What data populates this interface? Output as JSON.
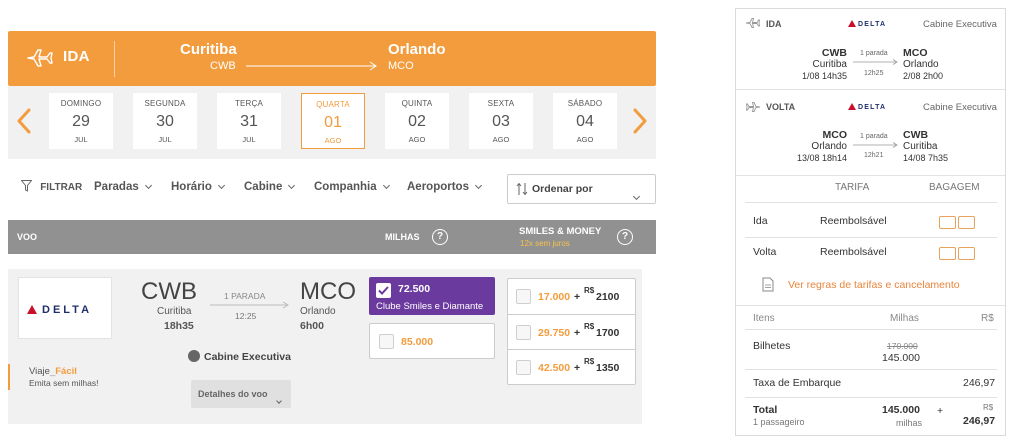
{
  "header": {
    "direction": "IDA",
    "origin_city": "Curitiba",
    "origin_code": "CWB",
    "dest_city": "Orlando",
    "dest_code": "MCO"
  },
  "dates": [
    {
      "dow": "DOMINGO",
      "day": "29",
      "month": "JUL"
    },
    {
      "dow": "SEGUNDA",
      "day": "30",
      "month": "JUL"
    },
    {
      "dow": "TERÇA",
      "day": "31",
      "month": "JUL"
    },
    {
      "dow": "QUARTA",
      "day": "01",
      "month": "AGO",
      "selected": true
    },
    {
      "dow": "QUINTA",
      "day": "02",
      "month": "AGO"
    },
    {
      "dow": "SEXTA",
      "day": "03",
      "month": "AGO"
    },
    {
      "dow": "SÁBADO",
      "day": "04",
      "month": "AGO"
    }
  ],
  "filters": {
    "filtrar": "FILTRAR",
    "paradas": "Paradas",
    "horario": "Horário",
    "cabine": "Cabine",
    "companhia": "Companhia",
    "aeroportos": "Aeroportos",
    "sort": "Ordenar por"
  },
  "table_header": {
    "voo": "VOO",
    "milhas": "MILHAS",
    "smiles_money": "SMILES & MONEY",
    "juros": "12x sem juros",
    "help": "?"
  },
  "flight": {
    "airline": "DELTA",
    "origin_code": "CWB",
    "origin_city": "Curitiba",
    "origin_time": "18h35",
    "stops": "1 PARADA",
    "duration": "12:25",
    "dest_code": "MCO",
    "dest_city": "Orlando",
    "dest_time": "6h00",
    "cabin": "Cabine Executiva",
    "promo_a": "Viaje",
    "promo_b": "Fácil",
    "promo_sub": "Emita sem milhas!",
    "details": "Detalhes do voo",
    "miles_selected_value": "72.500",
    "miles_selected_label": "Clube Smiles e Diamante",
    "miles_option": "85.000",
    "money_options": [
      {
        "miles": "17.000",
        "plus": "+",
        "currency": "R$",
        "price": "2100"
      },
      {
        "miles": "29.750",
        "plus": "+",
        "currency": "R$",
        "price": "1700"
      },
      {
        "miles": "42.500",
        "plus": "+",
        "currency": "R$",
        "price": "1350"
      }
    ]
  },
  "summary": {
    "outbound": {
      "label": "IDA",
      "airline": "DELTA",
      "cabin": "Cabine Executiva",
      "from_code": "CWB",
      "from_city": "Curitiba",
      "from_time": "1/08 14h35",
      "stops": "1 parada",
      "duration": "12h25",
      "to_code": "MCO",
      "to_city": "Orlando",
      "to_time": "2/08 2h00"
    },
    "inbound": {
      "label": "VOLTA",
      "airline": "DELTA",
      "cabin": "Cabine Executiva",
      "from_code": "MCO",
      "from_city": "Orlando",
      "from_time": "13/08 18h14",
      "stops": "1 parada",
      "duration": "12h21",
      "to_code": "CWB",
      "to_city": "Curitiba",
      "to_time": "14/08 7h35"
    },
    "fare_header": {
      "tarifa": "TARIFA",
      "bagagem": "BAGAGEM"
    },
    "fare_rows": [
      {
        "leg": "Ida",
        "fare": "Reembolsável"
      },
      {
        "leg": "Volta",
        "fare": "Reembolsável"
      }
    ],
    "rules_link": "Ver regras de tarifas e cancelamento",
    "cols": {
      "itens": "Itens",
      "milhas": "Milhas",
      "reais": "R$"
    },
    "bilhetes": {
      "label": "Bilhetes",
      "old": "170.000",
      "new": "145.000"
    },
    "taxa": {
      "label": "Taxa de Embarque",
      "value": "246,97"
    },
    "total": {
      "label": "Total",
      "sub": "1 passageiro",
      "miles": "145.000",
      "miles_unit": "milhas",
      "plus": "+",
      "currency": "R$",
      "value": "246,97"
    }
  },
  "colors": {
    "accent": "#f39c3e",
    "purple": "#6b3a9e",
    "header_gray": "#919191",
    "delta_red": "#c8102e",
    "delta_navy": "#1f2f6c"
  }
}
